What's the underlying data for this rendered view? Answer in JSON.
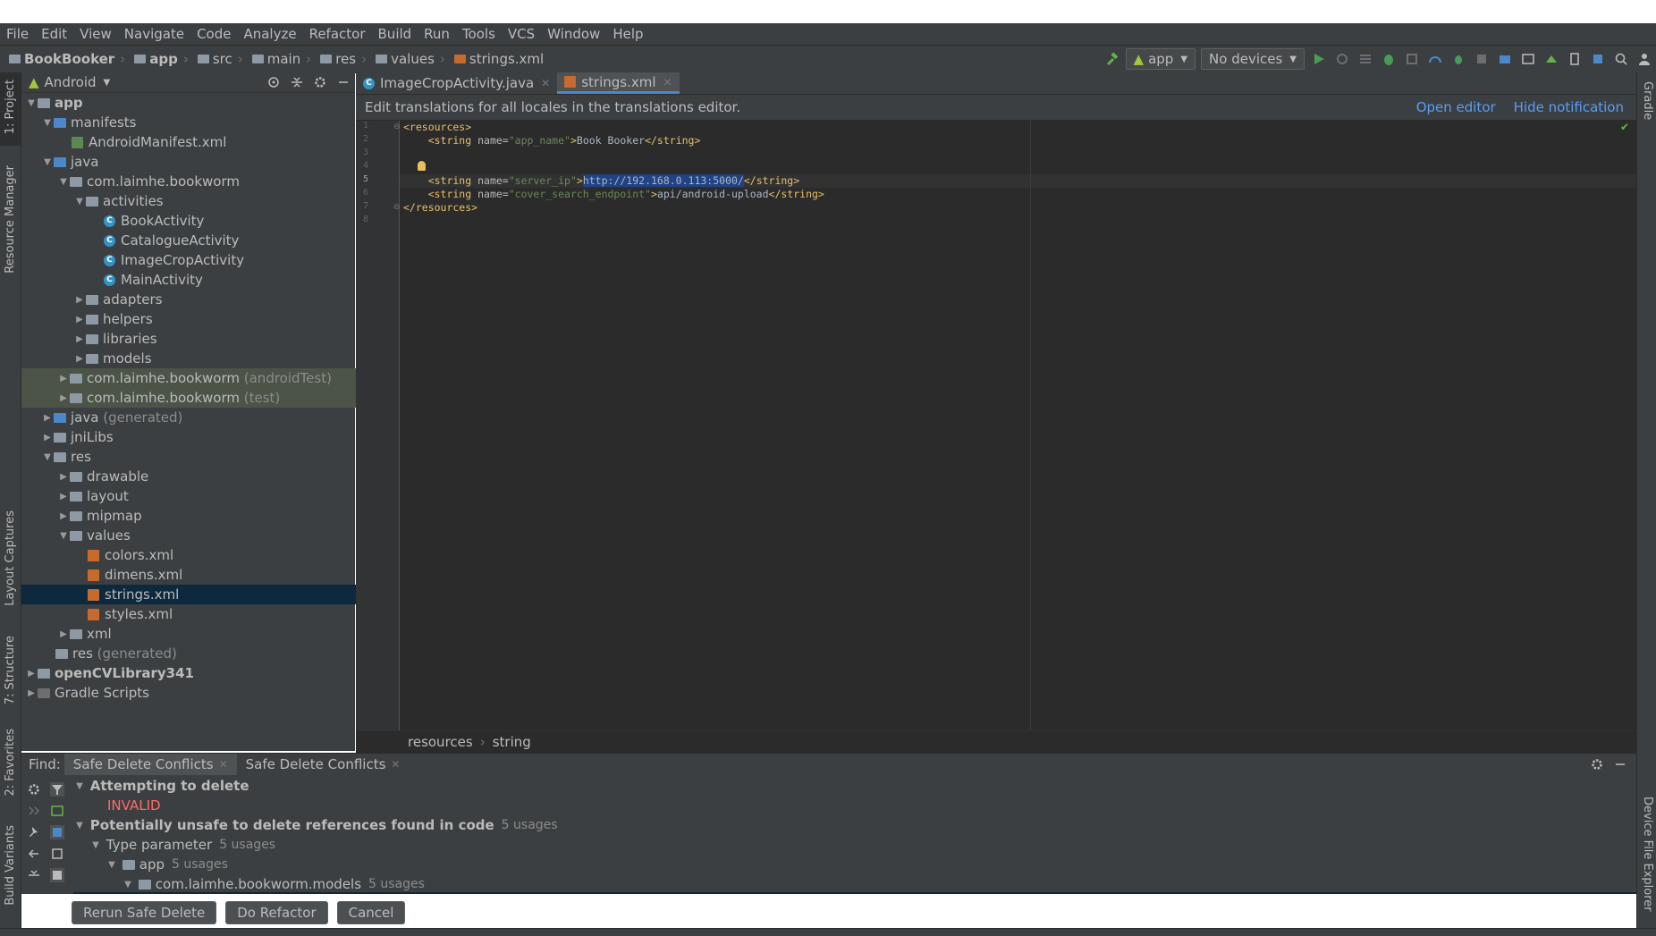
{
  "menu": [
    {
      "label": "File"
    },
    {
      "label": "Edit"
    },
    {
      "label": "View"
    },
    {
      "label": "Navigate"
    },
    {
      "label": "Code"
    },
    {
      "label": "Analyze"
    },
    {
      "label": "Refactor"
    },
    {
      "label": "Build"
    },
    {
      "label": "Run"
    },
    {
      "label": "Tools"
    },
    {
      "label": "VCS"
    },
    {
      "label": "Window"
    },
    {
      "label": "Help"
    }
  ],
  "breadcrumb": [
    "BookBooker",
    "app",
    "src",
    "main",
    "res",
    "values",
    "strings.xml"
  ],
  "toolbar": {
    "run_config": "app",
    "device": "No devices"
  },
  "left_stripe": {
    "project": "1: Project",
    "resource_manager": "Resource Manager",
    "layout_captures": "Layout Captures",
    "structure": "7: Structure",
    "favorites": "2: Favorites",
    "build_variants": "Build Variants"
  },
  "right_stripe": {
    "gradle": "Gradle",
    "device_file_explorer": "Device File Explorer"
  },
  "project": {
    "view_mode": "Android",
    "tree": [
      {
        "label": "app",
        "bold": true
      },
      {
        "label": "manifests"
      },
      {
        "label": "AndroidManifest.xml"
      },
      {
        "label": "java"
      },
      {
        "label": "com.laimhe.bookworm"
      },
      {
        "label": "activities"
      },
      {
        "label": "BookActivity"
      },
      {
        "label": "CatalogueActivity"
      },
      {
        "label": "ImageCropActivity"
      },
      {
        "label": "MainActivity"
      },
      {
        "label": "adapters"
      },
      {
        "label": "helpers"
      },
      {
        "label": "libraries"
      },
      {
        "label": "models"
      },
      {
        "label": "com.laimhe.bookworm",
        "suffix": "(androidTest)"
      },
      {
        "label": "com.laimhe.bookworm",
        "suffix": "(test)"
      },
      {
        "label": "java",
        "suffix": "(generated)"
      },
      {
        "label": "jniLibs"
      },
      {
        "label": "res"
      },
      {
        "label": "drawable"
      },
      {
        "label": "layout"
      },
      {
        "label": "mipmap"
      },
      {
        "label": "values"
      },
      {
        "label": "colors.xml"
      },
      {
        "label": "dimens.xml"
      },
      {
        "label": "strings.xml"
      },
      {
        "label": "styles.xml"
      },
      {
        "label": "xml"
      },
      {
        "label": "res",
        "suffix": "(generated)"
      },
      {
        "label": "openCVLibrary341",
        "bold": true
      },
      {
        "label": "Gradle Scripts"
      }
    ]
  },
  "editor": {
    "tabs": [
      {
        "label": "ImageCropActivity.java"
      },
      {
        "label": "strings.xml"
      }
    ],
    "notification": {
      "text": "Edit translations for all locales in the translations editor.",
      "open": "Open editor",
      "hide": "Hide notification"
    },
    "line_numbers": [
      "1",
      "2",
      "3",
      "4",
      "5",
      "6",
      "7",
      "8"
    ],
    "code": {
      "l1": "<resources>",
      "l2_open": "    <string ",
      "l2_attr": "name=",
      "l2_val": "\"app_name\"",
      "l2_close": ">",
      "l2_text": "Book Booker",
      "l2_end": "</string>",
      "l5_open": "    <string ",
      "l5_attr": "name=",
      "l5_val": "\"server_ip\"",
      "l5_close": ">",
      "l5_text": "http://192.168.0.113:5000/",
      "l5_end": "</string>",
      "l6_open": "    <string ",
      "l6_attr": "name=",
      "l6_val": "\"cover_search_endpoint\"",
      "l6_close": ">",
      "l6_text": "api/android-upload",
      "l6_end": "</string>",
      "l7": "</resources>"
    },
    "breadcrumb": [
      "resources",
      "string"
    ]
  },
  "find": {
    "label": "Find:",
    "tabs": [
      {
        "label": "Safe Delete Conflicts"
      },
      {
        "label": "Safe Delete Conflicts"
      }
    ],
    "rows": {
      "attempting": "Attempting to delete",
      "invalid": "INVALID",
      "unsafe": "Potentially unsafe to delete references found in code",
      "unsafe_count": "5 usages",
      "type_param": "Type parameter",
      "type_param_count": "5 usages",
      "app": "app",
      "app_count": "5 usages",
      "pkg": "com.laimhe.bookworm.models",
      "pkg_count": "5 usages"
    },
    "buttons": {
      "rerun": "Rerun Safe Delete",
      "refactor": "Do Refactor",
      "cancel": "Cancel"
    }
  },
  "colors": {
    "bg": "#3c3f41",
    "editor_bg": "#2b2b2b",
    "accent": "#4a88c7",
    "link": "#589df6",
    "error": "#ff6b68",
    "selection": "#0d293e"
  }
}
